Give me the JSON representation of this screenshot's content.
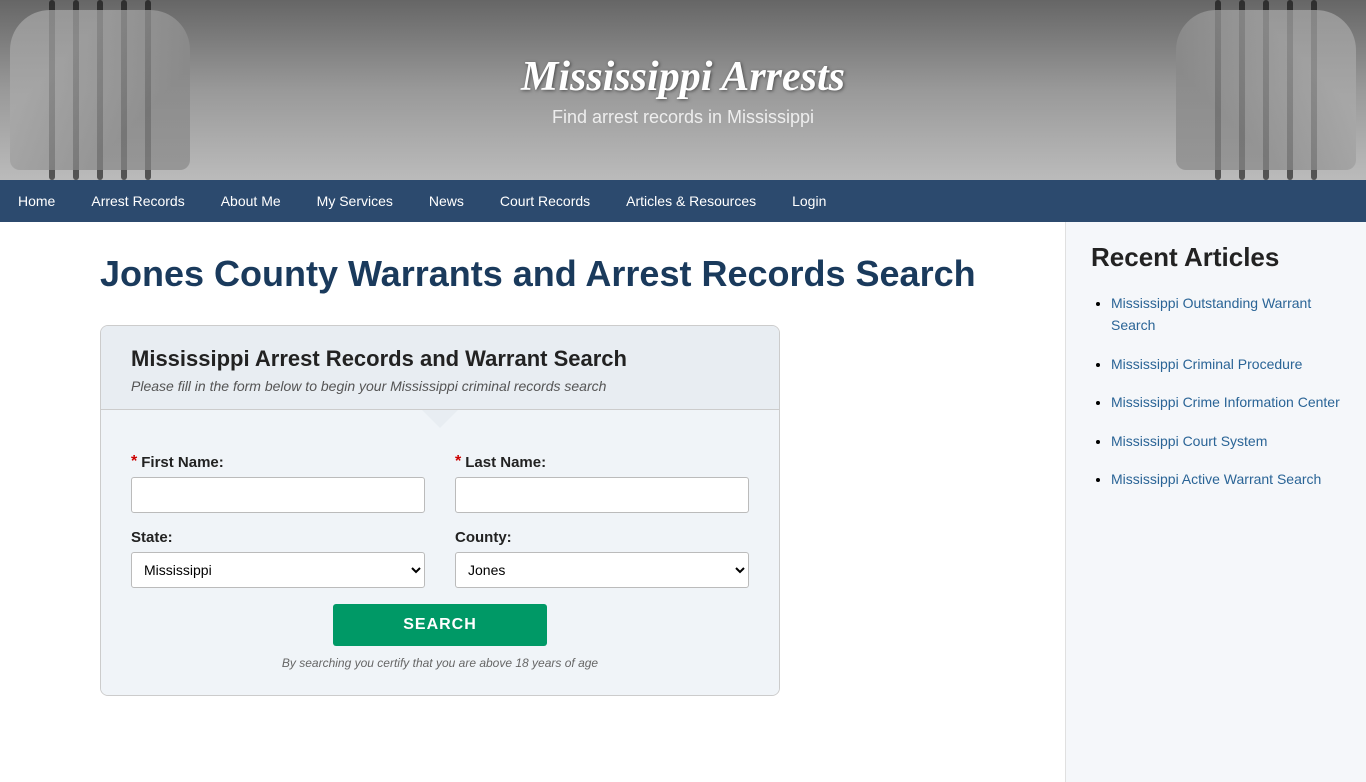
{
  "hero": {
    "title": "Mississippi Arrests",
    "subtitle": "Find arrest records in Mississippi"
  },
  "nav": {
    "items": [
      {
        "label": "Home",
        "active": false
      },
      {
        "label": "Arrest Records",
        "active": false
      },
      {
        "label": "About Me",
        "active": false
      },
      {
        "label": "My Services",
        "active": false
      },
      {
        "label": "News",
        "active": false
      },
      {
        "label": "Court Records",
        "active": false
      },
      {
        "label": "Articles & Resources",
        "active": false
      },
      {
        "label": "Login",
        "active": false
      }
    ]
  },
  "main": {
    "page_title": "Jones County Warrants and Arrest Records Search",
    "search_box": {
      "heading": "Mississippi Arrest Records and Warrant Search",
      "subheading": "Please fill in the form below to begin your Mississippi criminal records search",
      "first_name_label": "First Name:",
      "last_name_label": "Last Name:",
      "state_label": "State:",
      "county_label": "County:",
      "state_value": "Mississippi",
      "county_value": "Jones",
      "search_button": "SEARCH",
      "certify_text": "By searching you certify that you are above 18 years of age"
    }
  },
  "sidebar": {
    "title": "Recent Articles",
    "articles": [
      {
        "label": "Mississippi Outstanding Warrant Search"
      },
      {
        "label": "Mississippi Criminal Procedure"
      },
      {
        "label": "Mississippi Crime Information Center"
      },
      {
        "label": "Mississippi Court System"
      },
      {
        "label": "Mississippi Active Warrant Search"
      }
    ]
  }
}
